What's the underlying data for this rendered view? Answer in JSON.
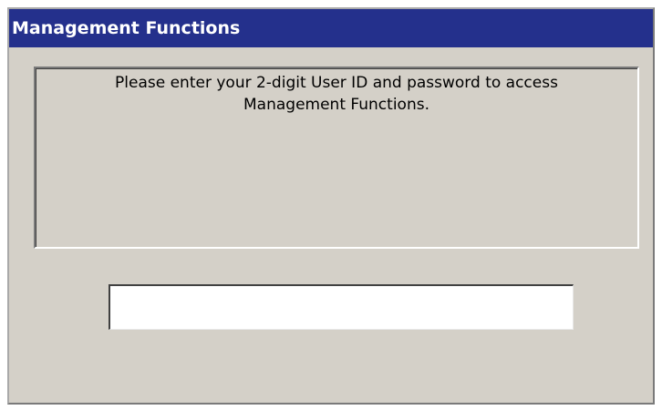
{
  "window": {
    "title": "Management Functions"
  },
  "message": {
    "line1": "Please enter your 2-digit User ID and password to access",
    "line2": "Management Functions."
  },
  "entry": {
    "value": "",
    "placeholder": ""
  },
  "colors": {
    "title_bar": "#24308c",
    "title_text": "#ffffff",
    "window_background": "#d4d0c8",
    "field_background": "#ffffff"
  }
}
